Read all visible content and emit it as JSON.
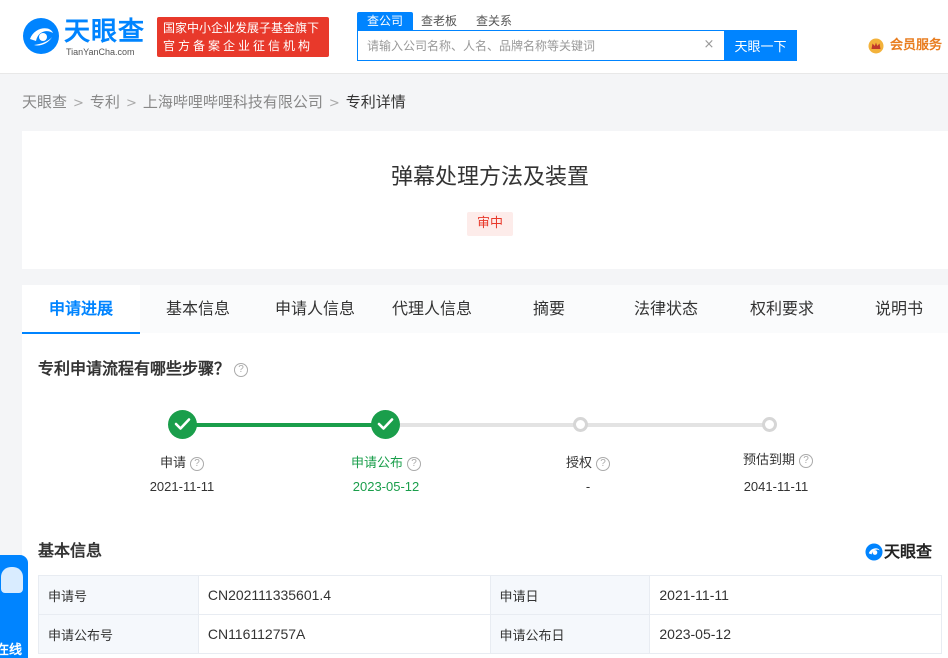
{
  "header": {
    "logo_cn": "天眼查",
    "logo_en": "TianYanCha.com",
    "gov_line1": "国家中小企业发展子基金旗下",
    "gov_line2": "官方备案企业征信机构",
    "search_tabs": [
      "查公司",
      "查老板",
      "查关系"
    ],
    "search_placeholder": "请输入公司名称、人名、品牌名称等关键词",
    "search_button": "天眼一下",
    "vip_label": "会员服务"
  },
  "breadcrumb": [
    "天眼查",
    "专利",
    "上海哔哩哔哩科技有限公司",
    "专利详情"
  ],
  "patent": {
    "title": "弹幕处理方法及装置",
    "status": "审中"
  },
  "tabs": [
    "申请进展",
    "基本信息",
    "申请人信息",
    "代理人信息",
    "摘要",
    "法律状态",
    "权利要求",
    "说明书"
  ],
  "progress": {
    "heading": "专利申请流程有哪些步骤？",
    "steps": [
      {
        "label": "申请",
        "date": "2021-11-11",
        "done": true
      },
      {
        "label": "申请公布",
        "date": "2023-05-12",
        "done": true
      },
      {
        "label": "授权",
        "date": "-",
        "done": false
      },
      {
        "label": "预估到期",
        "date": "2041-11-11",
        "done": false
      }
    ]
  },
  "basic_info": {
    "heading": "基本信息",
    "watermark": "天眼查",
    "rows": [
      {
        "k1": "申请号",
        "v1": "CN202111335601.4",
        "k2": "申请日",
        "v2": "2021-11-11"
      },
      {
        "k1": "申请公布号",
        "v1": "CN116112757A",
        "k2": "申请公布日",
        "v2": "2023-05-12"
      }
    ]
  },
  "float_widget": {
    "label": "在线"
  },
  "colors": {
    "brand": "#0084ff",
    "done": "#1a9e4b",
    "status": "#e8392b"
  }
}
